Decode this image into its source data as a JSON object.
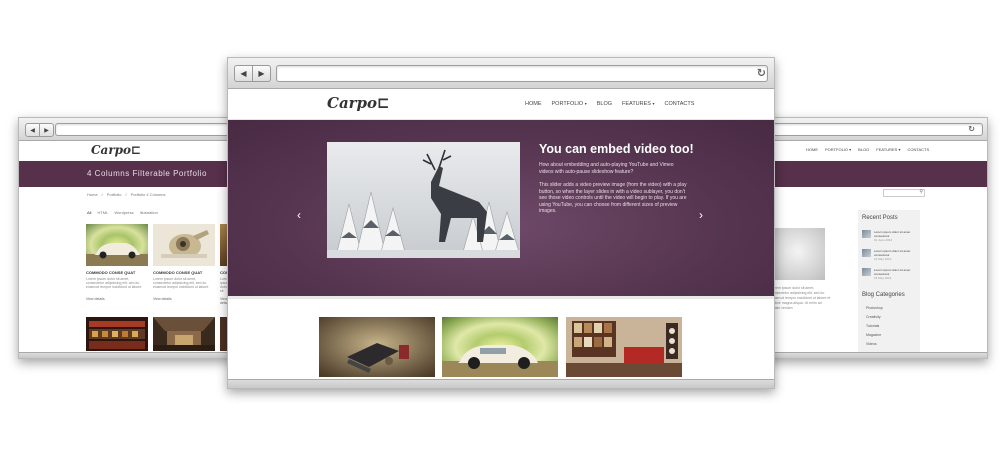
{
  "left_browser": {
    "nav": {
      "back_icon": "◀",
      "forward_icon": "▶"
    },
    "logo": "Carpo⊏",
    "page_title": "4 Columns Filterable Portfolio",
    "breadcrumb": [
      "Home",
      "/",
      "Portfolio",
      "/",
      "Portfolio 4 Columns"
    ],
    "filters": [
      "All",
      "HTML",
      "Wordpress",
      "Illustration"
    ],
    "items": [
      {
        "title": "COMMODO CONSE QUAT",
        "desc": "Lorem ipsum dolor sit amet, consectetur adipisicing elit, sed do eiusmod tempor incididunt ut labore",
        "link": "View details"
      },
      {
        "title": "COMMODO CONSE QUAT",
        "desc": "Lorem ipsum dolor sit amet, consectetur adipisicing elit, sed do eiusmod tempor incididunt ut labore",
        "link": "View details"
      },
      {
        "title": "COMMODO",
        "desc": "Lorem ipsum dolor sit amet, consectetur adipisicing elit, sed do eiusmod",
        "link": "View details"
      }
    ]
  },
  "right_browser": {
    "reload_icon": "↻",
    "menu": [
      "HOME",
      "PORTFOLIO ▾",
      "BLOG",
      "FEATURES ▾",
      "CONTACTS"
    ],
    "search_icon": "⚲",
    "text": "Lorem ipsum dolor sit amet, consectetur adipisicing elit, sed do eiusmod tempor incididunt ut labore et dolore magna aliqua. Ut enim ad minim veniam",
    "sidebar": {
      "recent_posts_title": "Recent Posts",
      "posts": [
        {
          "title": "Lorem ipsum dolor sit amet consectetur",
          "date": "01 June 2013"
        },
        {
          "title": "Lorem ipsum dolor sit amet consectetur",
          "date": "21 May 2013"
        },
        {
          "title": "Lorem ipsum dolor sit amet consectetur",
          "date": "15 May 2013"
        }
      ],
      "categories_title": "Blog Categories",
      "categories": [
        "Photoshop",
        "Creativity",
        "Tutorials",
        "Magazine",
        "Videos"
      ]
    }
  },
  "main_browser": {
    "nav": {
      "back_icon": "◀",
      "forward_icon": "▶"
    },
    "reload_icon": "↻",
    "logo": "Carpo⊏",
    "menu": [
      {
        "label": "HOME",
        "caret": ""
      },
      {
        "label": "PORTFOLIO",
        "caret": "▾"
      },
      {
        "label": "BLOG",
        "caret": ""
      },
      {
        "label": "FEATURES",
        "caret": "▾"
      },
      {
        "label": "CONTACTS",
        "caret": ""
      }
    ],
    "slider": {
      "heading": "You can embed video too!",
      "paragraph_1": "How about embedding and auto-playing YouTube and Vimeo videos with auto-pause slideshow feature?",
      "paragraph_2": "This slider adds a video preview image (from the video) with a play button, so when the layer slides in with a video sublayer, you don't see those video controls until the video will begin to play. If you are using YouTube, you can choose from different sizes of preview images.",
      "prev_arrow": "‹",
      "next_arrow": "›"
    }
  },
  "colors": {
    "accent": "#57304b",
    "slider_bg": "#5a3954"
  }
}
